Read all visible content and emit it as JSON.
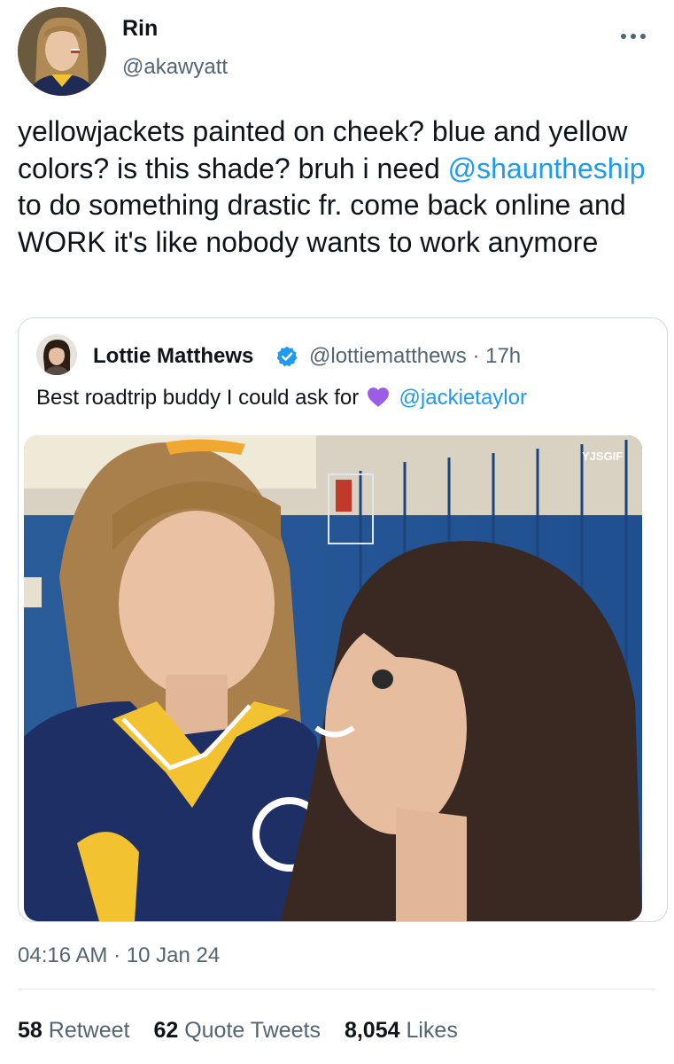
{
  "author": {
    "display_name": "Rin",
    "handle": "@akawyatt",
    "avatar_icon": "profile-photo"
  },
  "tweet": {
    "text_1": "yellowjackets painted on cheek? blue and yellow colors? is this shade? bruh i need ",
    "mention": "@shauntheship",
    "text_2": " to do something drastic fr. come back online and WORK it's like nobody wants to work anymore"
  },
  "quoted": {
    "display_name": "Lottie Matthews",
    "handle": "@lottiematthews",
    "separator": "·",
    "age": "17h",
    "text": "Best roadtrip buddy I could ask for",
    "emoji_icon": "purple-heart",
    "mention": "@jackietaylor",
    "media_watermark": "YJSGIF"
  },
  "meta": {
    "time": "04:16 AM",
    "separator": "·",
    "date": "10 Jan 24"
  },
  "stats": {
    "retweets_count": "58",
    "retweets_label": "Retweet",
    "quotes_count": "62",
    "quotes_label": "Quote Tweets",
    "likes_count": "8,054",
    "likes_label": "Likes"
  },
  "colors": {
    "link": "#1d9bf0",
    "secondary_text": "#536471",
    "verified": "#1d9bf0",
    "heart": "#9b5de5",
    "border": "#cfd9de"
  }
}
